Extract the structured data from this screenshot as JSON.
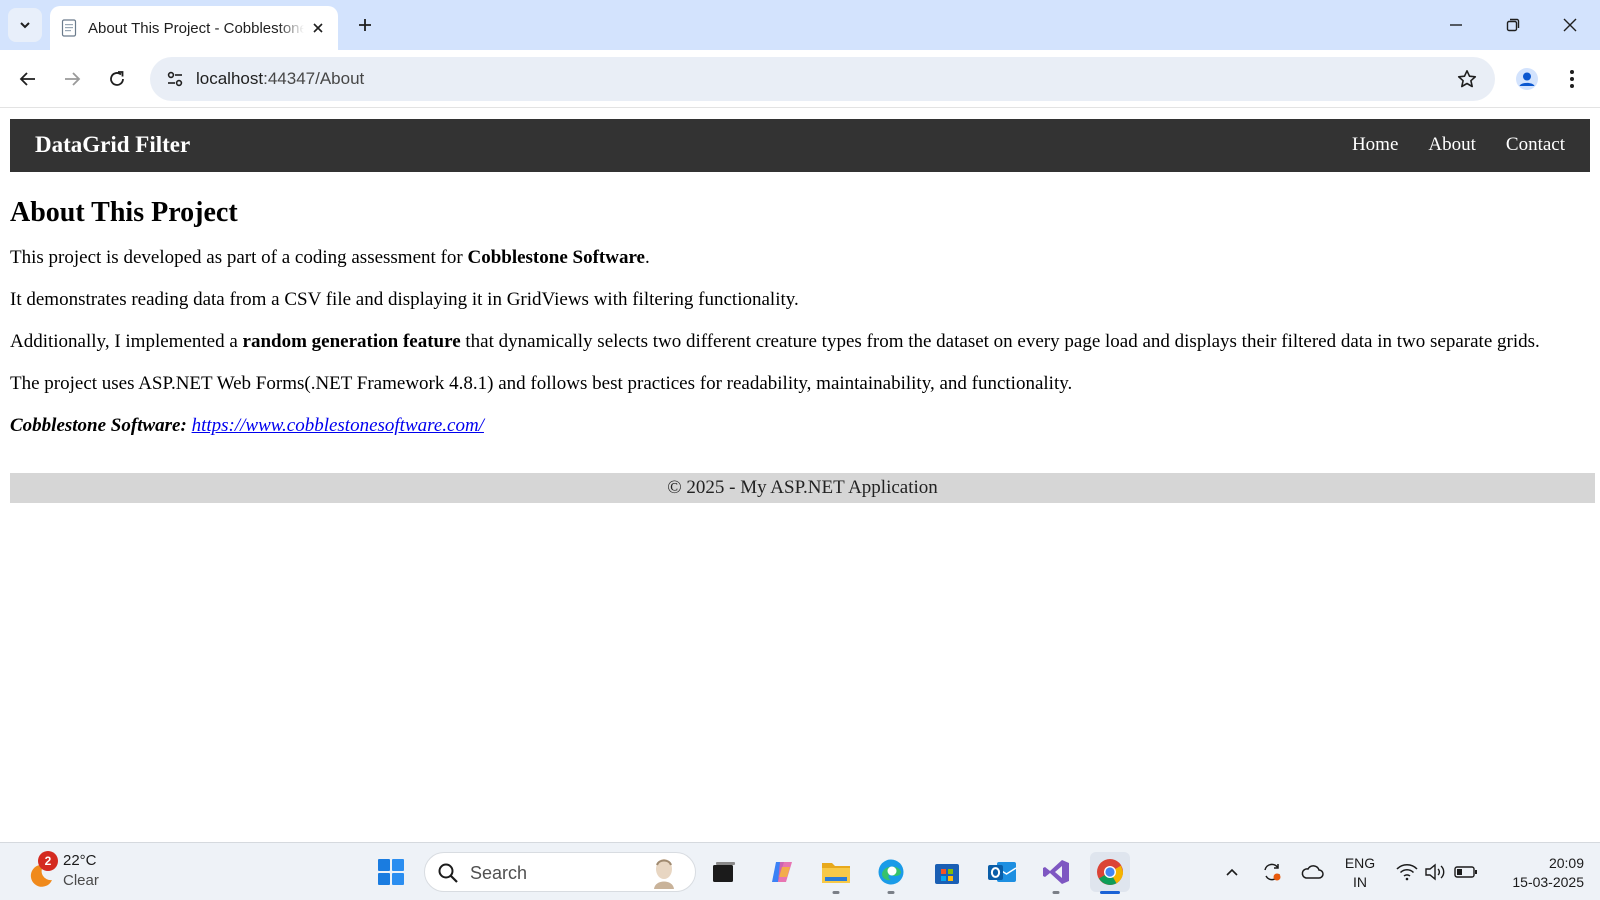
{
  "browser": {
    "tab_title": "About This Project - Cobblestone Software",
    "url_host": "localhost",
    "url_rest": ":44347/About",
    "new_tab": "+"
  },
  "site": {
    "brand": "DataGrid Filter",
    "nav": [
      "Home",
      "About",
      "Contact"
    ]
  },
  "content": {
    "heading": "About This Project",
    "p1_before": "This project is developed as part of a coding assessment for ",
    "p1_bold": "Cobblestone Software",
    "p1_after": ".",
    "p2": "It demonstrates reading data from a CSV file and displaying it in GridViews with filtering functionality.",
    "p3_before": "Additionally, I implemented a ",
    "p3_bold": "random generation feature",
    "p3_after": " that dynamically selects two different creature types from the dataset on every page load and displays their filtered data in two separate grids.",
    "p4": "The project uses ASP.NET Web Forms(.NET Framework 4.8.1) and follows best practices for readability, maintainability, and functionality.",
    "link_label": "Cobblestone Software:",
    "link_url": "https://www.cobblestonesoftware.com/"
  },
  "footer": "© 2025 - My ASP.NET Application",
  "taskbar": {
    "weather_badge": "2",
    "temperature": "22°C",
    "condition": "Clear",
    "search_placeholder": "Search",
    "language_line1": "ENG",
    "language_line2": "IN",
    "time": "20:09",
    "date": "15-03-2025"
  },
  "colors": {
    "navbar": "#333333",
    "footer": "#d6d6d6",
    "tabstrip": "#d3e3fd",
    "link": "#0000ee"
  }
}
